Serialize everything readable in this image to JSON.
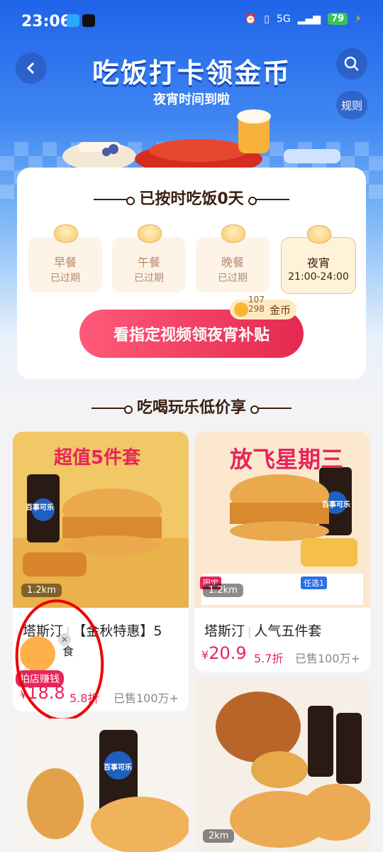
{
  "status": {
    "time": "23:06",
    "net": "5G",
    "battery": "79"
  },
  "header": {
    "back_icon": "back-arrow-icon",
    "title": "吃饭打卡领金币",
    "subtitle": "夜宵时间到啦",
    "search_icon": "search-icon",
    "rules_label": "规则"
  },
  "checkin": {
    "heading": "已按时吃饭0天",
    "meals": [
      {
        "name": "早餐",
        "status": "已过期"
      },
      {
        "name": "午餐",
        "status": "已过期"
      },
      {
        "name": "晚餐",
        "status": "已过期"
      },
      {
        "name": "夜宵",
        "status": "21:00-24:00"
      }
    ],
    "coin_tag": {
      "amount_top": "107",
      "amount_bottom": "298",
      "label": "金币"
    },
    "cta_label": "看指定视频领夜宵补贴"
  },
  "deals": {
    "heading": "吃喝玩乐低价享",
    "items": [
      {
        "banner": "超值5件套",
        "distance": "1.2km",
        "store": "塔斯汀",
        "name": "【金秋特惠】5",
        "line2": "食",
        "price": "18.8",
        "discount": "5.8折",
        "sold": "已售100万+",
        "badge": "拍店赚钱"
      },
      {
        "banner": "放飞星期三",
        "distance": "1.2km",
        "store": "塔斯汀",
        "name": "人气五件套",
        "price": "20.9",
        "discount": "5.7折",
        "sold": "已售100万+"
      },
      {
        "distance": "",
        "store": "",
        "name": ""
      },
      {
        "distance": "2km",
        "store": "",
        "name": ""
      }
    ],
    "brand_text": "百事可乐",
    "promo_labels": [
      "固定",
      "任选1"
    ]
  },
  "colors": {
    "accent": "#e8245a",
    "primary_blue": "#1f63e8"
  }
}
